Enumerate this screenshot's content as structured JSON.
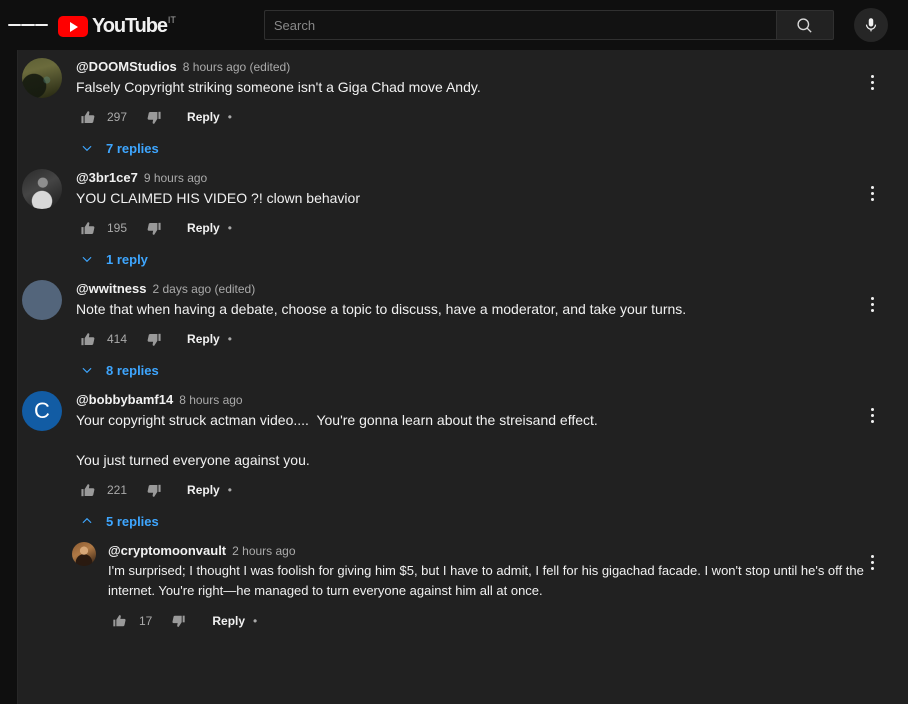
{
  "masthead": {
    "menu_icon": "hamburger-menu-icon",
    "logo_text": "YouTube",
    "logo_country_code": "IT",
    "search_placeholder": "Search",
    "search_value": "",
    "search_icon": "search-icon",
    "mic_icon": "microphone-icon",
    "brand_color": "#ff0000"
  },
  "comments": [
    {
      "author": "@DOOMStudios",
      "timestamp": "8 hours ago (edited)",
      "text": "Falsely Copyright striking someone isn't a Giga Chad move Andy.",
      "likes": "297",
      "reply_label": "Reply",
      "dot": "•",
      "replies_label": "7 replies",
      "expanded": false,
      "avatar_kind": "photo-olive",
      "menu_icon": "kebab-menu-icon",
      "like_icon": "thumbs-up-icon",
      "dislike_icon": "thumbs-down-icon"
    },
    {
      "author": "@3br1ce7",
      "timestamp": "9 hours ago",
      "text": "YOU CLAIMED HIS VIDEO ?! clown behavior",
      "likes": "195",
      "reply_label": "Reply",
      "dot": "•",
      "replies_label": "1 reply",
      "expanded": false,
      "avatar_kind": "photo-grayscale",
      "menu_icon": "kebab-menu-icon",
      "like_icon": "thumbs-up-icon",
      "dislike_icon": "thumbs-down-icon"
    },
    {
      "author": "@wwitness",
      "timestamp": "2 days ago (edited)",
      "text": "Note that when having a debate, choose a topic to discuss, have a moderator, and take your turns.",
      "likes": "414",
      "reply_label": "Reply",
      "dot": "•",
      "replies_label": "8 replies",
      "expanded": false,
      "avatar_kind": "photo-hooded",
      "menu_icon": "kebab-menu-icon",
      "like_icon": "thumbs-up-icon",
      "dislike_icon": "thumbs-down-icon"
    },
    {
      "author": "@bobbybamf14",
      "timestamp": "8 hours ago",
      "text": "Your copyright struck actman video....  You're gonna learn about the streisand effect.\n\nYou just turned everyone against you.",
      "likes": "221",
      "reply_label": "Reply",
      "dot": "•",
      "replies_label": "5 replies",
      "expanded": true,
      "avatar_kind": "letter",
      "avatar_letter": "C",
      "avatar_color": "#125ca4",
      "menu_icon": "kebab-menu-icon",
      "like_icon": "thumbs-up-icon",
      "dislike_icon": "thumbs-down-icon",
      "replies": [
        {
          "author": "@cryptomoonvault",
          "timestamp": "2 hours ago",
          "text": "I'm surprised; I thought I was foolish for giving him $5, but I have to admit, I fell for his gigachad facade. I won't stop until he's off the internet. You're right—he managed to turn everyone against him all at once.",
          "likes": "17",
          "reply_label": "Reply",
          "dot": "•",
          "avatar_kind": "photo-portrait",
          "menu_icon": "kebab-menu-icon",
          "like_icon": "thumbs-up-icon",
          "dislike_icon": "thumbs-down-icon"
        }
      ]
    }
  ],
  "theme": {
    "page_bg": "#0f0f0f",
    "panel_bg": "#212121",
    "link_color": "#3ea6ff",
    "primary_text": "#f1f1f1",
    "secondary_text": "#aaaaaa"
  }
}
